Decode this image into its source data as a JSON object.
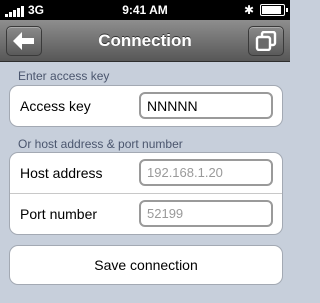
{
  "status": {
    "carrier": "3G",
    "time": "9:41 AM"
  },
  "nav": {
    "title": "Connection"
  },
  "sections": {
    "access_key": "Enter access key",
    "host_port": "Or host address & port number"
  },
  "fields": {
    "access_key": {
      "label": "Access key",
      "value": "NNNNN"
    },
    "host_address": {
      "label": "Host address",
      "placeholder": "192.168.1.20"
    },
    "port_number": {
      "label": "Port number",
      "placeholder": "52199"
    }
  },
  "save_label": "Save connection",
  "icons": {
    "back": "left-arrow-icon",
    "copy": "copy-icon",
    "bluetooth": "bluetooth-icon",
    "battery": "battery-icon"
  },
  "colors": {
    "navbar": "#6e6e6e",
    "background": "#c7cfdb",
    "section_label": "#4b566e"
  }
}
